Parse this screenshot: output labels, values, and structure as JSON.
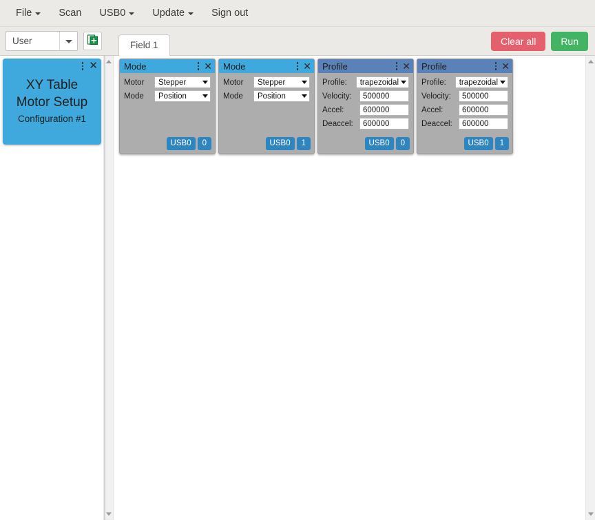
{
  "menubar": {
    "items": [
      {
        "label": "File",
        "has_caret": true
      },
      {
        "label": "Scan",
        "has_caret": false
      },
      {
        "label": "USB0",
        "has_caret": true
      },
      {
        "label": "Update",
        "has_caret": true
      },
      {
        "label": "Sign out",
        "has_caret": false
      }
    ]
  },
  "toolbar": {
    "user_select_value": "User",
    "add_field_icon": "add-pages-icon",
    "tabs": [
      {
        "label": "Field 1",
        "active": true
      }
    ],
    "clear_all_label": "Clear all",
    "run_label": "Run",
    "clear_all_color": "#e4606d",
    "run_color": "#42b463"
  },
  "config_card": {
    "title_line1": "XY Table",
    "title_line2": "Motor Setup",
    "subtitle": "Configuration #1",
    "color": "#3fa9dd",
    "menu_icon": "kebab-menu-icon",
    "close_icon": "close-icon"
  },
  "panels": [
    {
      "title": "Mode",
      "type": "mode",
      "header_color": "#3fa9dd",
      "fields": [
        {
          "label": "Motor",
          "control": "select",
          "value": "Stepper"
        },
        {
          "label": "Mode",
          "control": "select",
          "value": "Position"
        }
      ],
      "device_badge": "USB0",
      "index_badge": "0"
    },
    {
      "title": "Mode",
      "type": "mode",
      "header_color": "#3fa9dd",
      "fields": [
        {
          "label": "Motor",
          "control": "select",
          "value": "Stepper"
        },
        {
          "label": "Mode",
          "control": "select",
          "value": "Position"
        }
      ],
      "device_badge": "USB0",
      "index_badge": "1"
    },
    {
      "title": "Profile",
      "type": "profile",
      "header_color": "#5b82b8",
      "fields": [
        {
          "label": "Profile:",
          "control": "select",
          "value": "trapezoidal"
        },
        {
          "label": "Velocity:",
          "control": "input",
          "value": "500000"
        },
        {
          "label": "Accel:",
          "control": "input",
          "value": "600000"
        },
        {
          "label": "Deaccel:",
          "control": "input",
          "value": "600000"
        }
      ],
      "device_badge": "USB0",
      "index_badge": "0"
    },
    {
      "title": "Profile",
      "type": "profile",
      "header_color": "#5b82b8",
      "fields": [
        {
          "label": "Profile:",
          "control": "select",
          "value": "trapezoidal"
        },
        {
          "label": "Velocity:",
          "control": "input",
          "value": "500000"
        },
        {
          "label": "Accel:",
          "control": "input",
          "value": "600000"
        },
        {
          "label": "Deaccel:",
          "control": "input",
          "value": "600000"
        }
      ],
      "device_badge": "USB0",
      "index_badge": "1"
    }
  ],
  "scrollbars": {
    "left": {
      "up_icon": "scroll-up-arrow-icon",
      "down_icon": "scroll-down-arrow-icon"
    },
    "right": {
      "up_icon": "scroll-up-arrow-icon",
      "down_icon": "scroll-down-arrow-icon"
    }
  }
}
